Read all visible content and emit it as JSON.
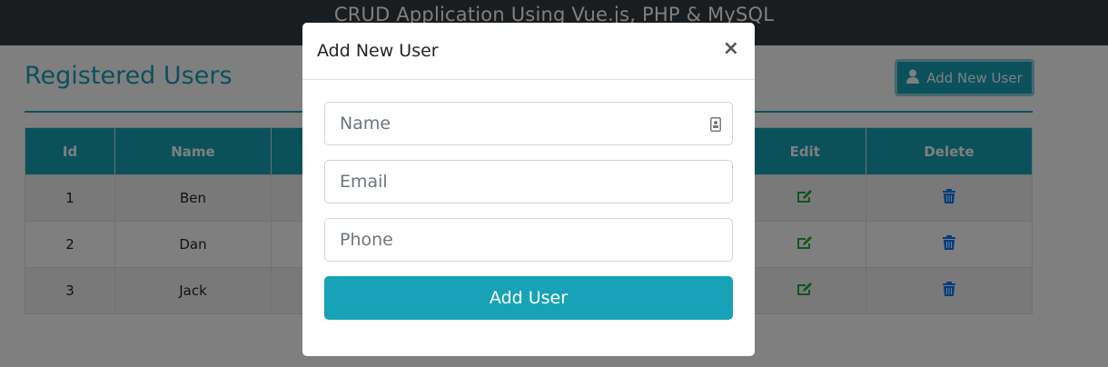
{
  "navbar": {
    "title": "CRUD Application Using Vue.js, PHP & MySQL"
  },
  "page": {
    "heading": "Registered Users",
    "add_button_label": "Add New User"
  },
  "table": {
    "headers": [
      "Id",
      "Name",
      "",
      "",
      "",
      "Edit",
      "Delete"
    ],
    "rows": [
      {
        "id": "1",
        "name": "Ben"
      },
      {
        "id": "2",
        "name": "Dan"
      },
      {
        "id": "3",
        "name": "Jack"
      }
    ]
  },
  "modal": {
    "title": "Add New User",
    "close_label": "×",
    "name_placeholder": "Name",
    "email_placeholder": "Email",
    "phone_placeholder": "Phone",
    "submit_label": "Add User"
  },
  "colors": {
    "accent": "#17a2b8",
    "navbar": "#343a40",
    "edit": "#28a745",
    "delete": "#007bff"
  },
  "icons": {
    "add_button": "user-icon",
    "field_name": "contact-card-icon",
    "edit": "edit-icon",
    "delete": "trash-icon"
  }
}
